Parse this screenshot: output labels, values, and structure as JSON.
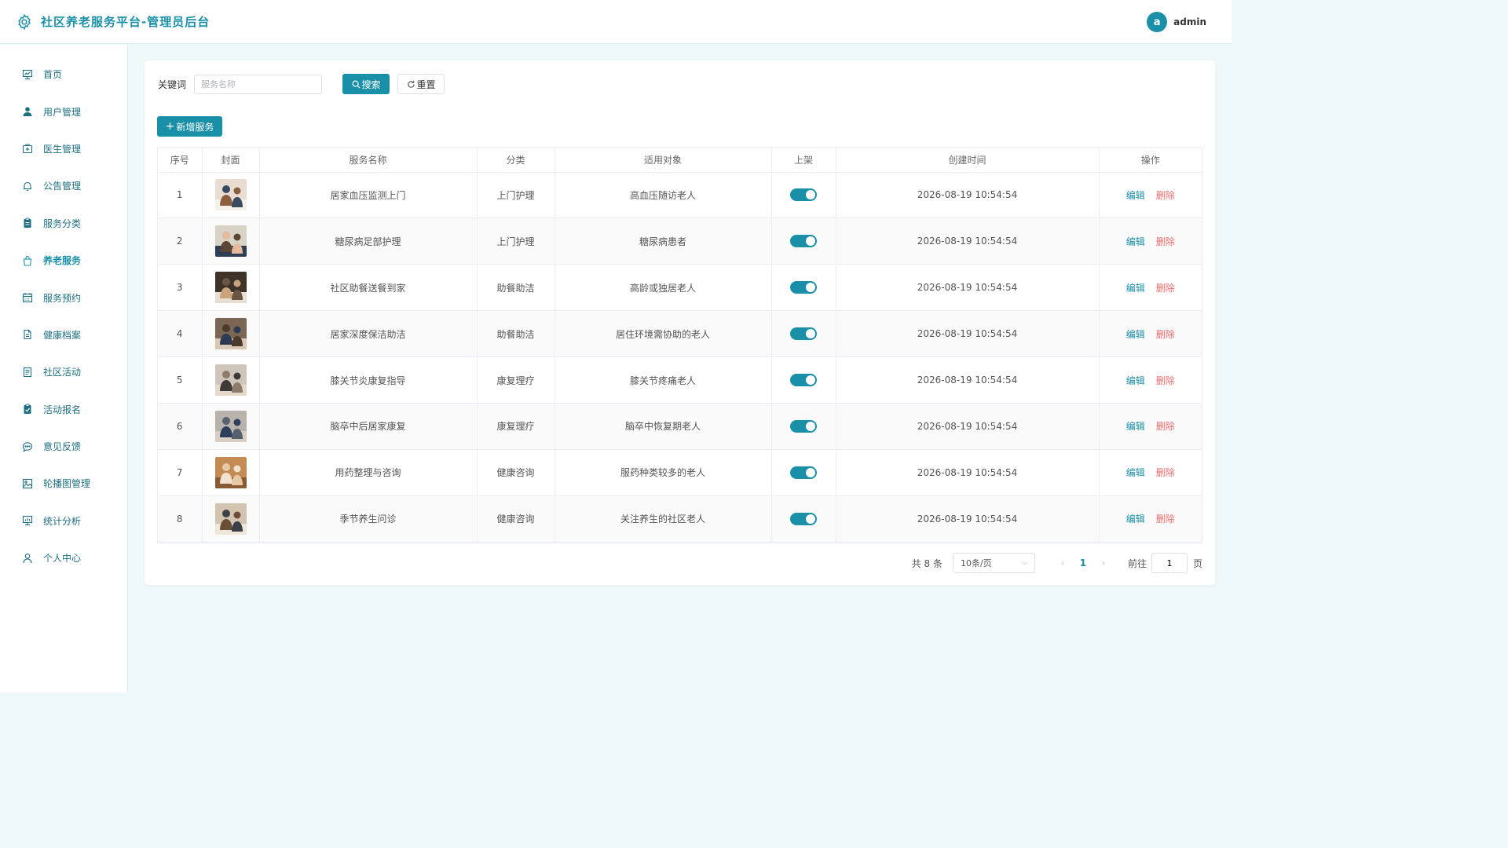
{
  "app": {
    "title": "社区养老服务平台-管理员后台",
    "user": {
      "avatar_letter": "a",
      "name": "admin"
    },
    "accent_color": "#1a8fa8",
    "danger_color": "#f56c6c"
  },
  "sidebar": {
    "items": [
      {
        "label": "首页",
        "icon": "dashboard-icon",
        "active": false
      },
      {
        "label": "用户管理",
        "icon": "user-icon",
        "active": false
      },
      {
        "label": "医生管理",
        "icon": "medical-kit-icon",
        "active": false
      },
      {
        "label": "公告管理",
        "icon": "bell-icon",
        "active": false
      },
      {
        "label": "服务分类",
        "icon": "clipboard-icon",
        "active": false
      },
      {
        "label": "养老服务",
        "icon": "shopping-bag-icon",
        "active": true
      },
      {
        "label": "服务预约",
        "icon": "calendar-icon",
        "active": false
      },
      {
        "label": "健康档案",
        "icon": "document-icon",
        "active": false
      },
      {
        "label": "社区活动",
        "icon": "list-document-icon",
        "active": false
      },
      {
        "label": "活动报名",
        "icon": "checklist-icon",
        "active": false
      },
      {
        "label": "意见反馈",
        "icon": "chat-bubble-icon",
        "active": false
      },
      {
        "label": "轮播图管理",
        "icon": "image-icon",
        "active": false
      },
      {
        "label": "统计分析",
        "icon": "chart-icon",
        "active": false
      },
      {
        "label": "个人中心",
        "icon": "person-outline-icon",
        "active": false
      }
    ]
  },
  "search": {
    "label": "关键词",
    "placeholder": "服务名称",
    "value": "",
    "search_button": "搜索",
    "reset_button": "重置"
  },
  "toolbar": {
    "add_button": "新增服务"
  },
  "table": {
    "headers": [
      "序号",
      "封面",
      "服务名称",
      "分类",
      "适用对象",
      "上架",
      "创建时间",
      "操作"
    ],
    "edit_label": "编辑",
    "delete_label": "删除",
    "rows": [
      {
        "index": "1",
        "name": "居家血压监测上门",
        "category": "上门护理",
        "target": "高血压随访老人",
        "on_shelf": true,
        "created": "2026-08-19 10:54:54"
      },
      {
        "index": "2",
        "name": "糖尿病足部护理",
        "category": "上门护理",
        "target": "糖尿病患者",
        "on_shelf": true,
        "created": "2026-08-19 10:54:54"
      },
      {
        "index": "3",
        "name": "社区助餐送餐到家",
        "category": "助餐助洁",
        "target": "高龄或独居老人",
        "on_shelf": true,
        "created": "2026-08-19 10:54:54"
      },
      {
        "index": "4",
        "name": "居家深度保洁助洁",
        "category": "助餐助洁",
        "target": "居住环境需协助的老人",
        "on_shelf": true,
        "created": "2026-08-19 10:54:54"
      },
      {
        "index": "5",
        "name": "膝关节炎康复指导",
        "category": "康复理疗",
        "target": "膝关节疼痛老人",
        "on_shelf": true,
        "created": "2026-08-19 10:54:54"
      },
      {
        "index": "6",
        "name": "脑卒中后居家康复",
        "category": "康复理疗",
        "target": "脑卒中恢复期老人",
        "on_shelf": true,
        "created": "2026-08-19 10:54:54"
      },
      {
        "index": "7",
        "name": "用药整理与咨询",
        "category": "健康咨询",
        "target": "服药种类较多的老人",
        "on_shelf": true,
        "created": "2026-08-19 10:54:54"
      },
      {
        "index": "8",
        "name": "季节养生问诊",
        "category": "健康咨询",
        "target": "关注养生的社区老人",
        "on_shelf": true,
        "created": "2026-08-19 10:54:54"
      }
    ]
  },
  "pagination": {
    "total_text": "共 8 条",
    "page_size": "10条/页",
    "current_page": "1",
    "goto_label": "前往",
    "goto_value": "1",
    "goto_suffix": "页"
  }
}
